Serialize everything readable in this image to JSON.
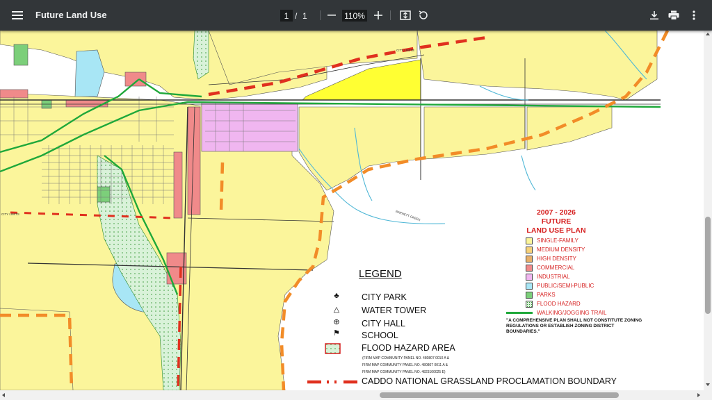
{
  "toolbar": {
    "menu_icon": "hamburger-menu-icon",
    "title": "Future Land Use",
    "page_current": "1",
    "page_separator": "/",
    "page_total": "1",
    "zoom_out_icon": "minus-icon",
    "zoom_level": "110%",
    "zoom_in_icon": "plus-icon",
    "fit_icon": "fit-to-page-icon",
    "rotate_icon": "rotate-icon",
    "download_icon": "download-icon",
    "print_icon": "print-icon",
    "more_icon": "more-vert-icon"
  },
  "plan": {
    "years": "2007 - 2026",
    "title_1": "FUTURE",
    "title_2": "LAND USE PLAN",
    "categories": [
      {
        "label": "SINGLE-FAMILY",
        "color": "#fbf59b"
      },
      {
        "label": "MEDIUM DENSITY",
        "color": "#f7d27a"
      },
      {
        "label": "HIGH DENSITY",
        "color": "#e8b06a"
      },
      {
        "label": "COMMERCIAL",
        "color": "#f08a8a"
      },
      {
        "label": "INDUSTRIAL",
        "color": "#f0b6f0"
      },
      {
        "label": "PUBLIC/SEMI-PUBLIC",
        "color": "#a8e6f5"
      },
      {
        "label": "PARKS",
        "color": "#7ccf7a"
      },
      {
        "label": "FLOOD HAZARD",
        "color": "#d9f2d9"
      }
    ],
    "trail": "WALKING/JOGGING TRAIL",
    "disclaimer": "\"A COMPREHENSIVE PLAN SHALL NOT CONSTITUTE ZONING REGULATIONS OR ESTABLISH ZONING DISTRICT BOUNDARIES.\""
  },
  "legend": {
    "title": "LEGEND",
    "items": {
      "city_park": "CITY PARK",
      "water_tower": "WATER TOWER",
      "city_hall": "CITY HALL",
      "school": "SCHOOL",
      "flood": "FLOOD HAZARD AREA"
    },
    "panels": [
      "(FIRM MAP COMMUNITY PANEL NO. 480807 0010 A &",
      "FIRM MAP COMMUNITY PANEL NO. 480807 0011 A &",
      "FIRM MAP COMMUNITY PANEL NO. 4823100025 E)"
    ],
    "boundary": "CADDO NATIONAL GRASSLAND PROCLAMATION BOUNDARY"
  },
  "map_labels": {
    "city_limits": "CITY LIMITS",
    "barnett_creek": "BARNETT CREEK",
    "city_limits_2": "CITY LIMITS"
  },
  "colors": {
    "single_family": "#fbf59b",
    "boundary_red": "#e0301e",
    "boundary_orange": "#f28c28",
    "trail_green": "#1fa83a",
    "water": "#a8e6f5",
    "bright_yellow": "#ffff33"
  }
}
